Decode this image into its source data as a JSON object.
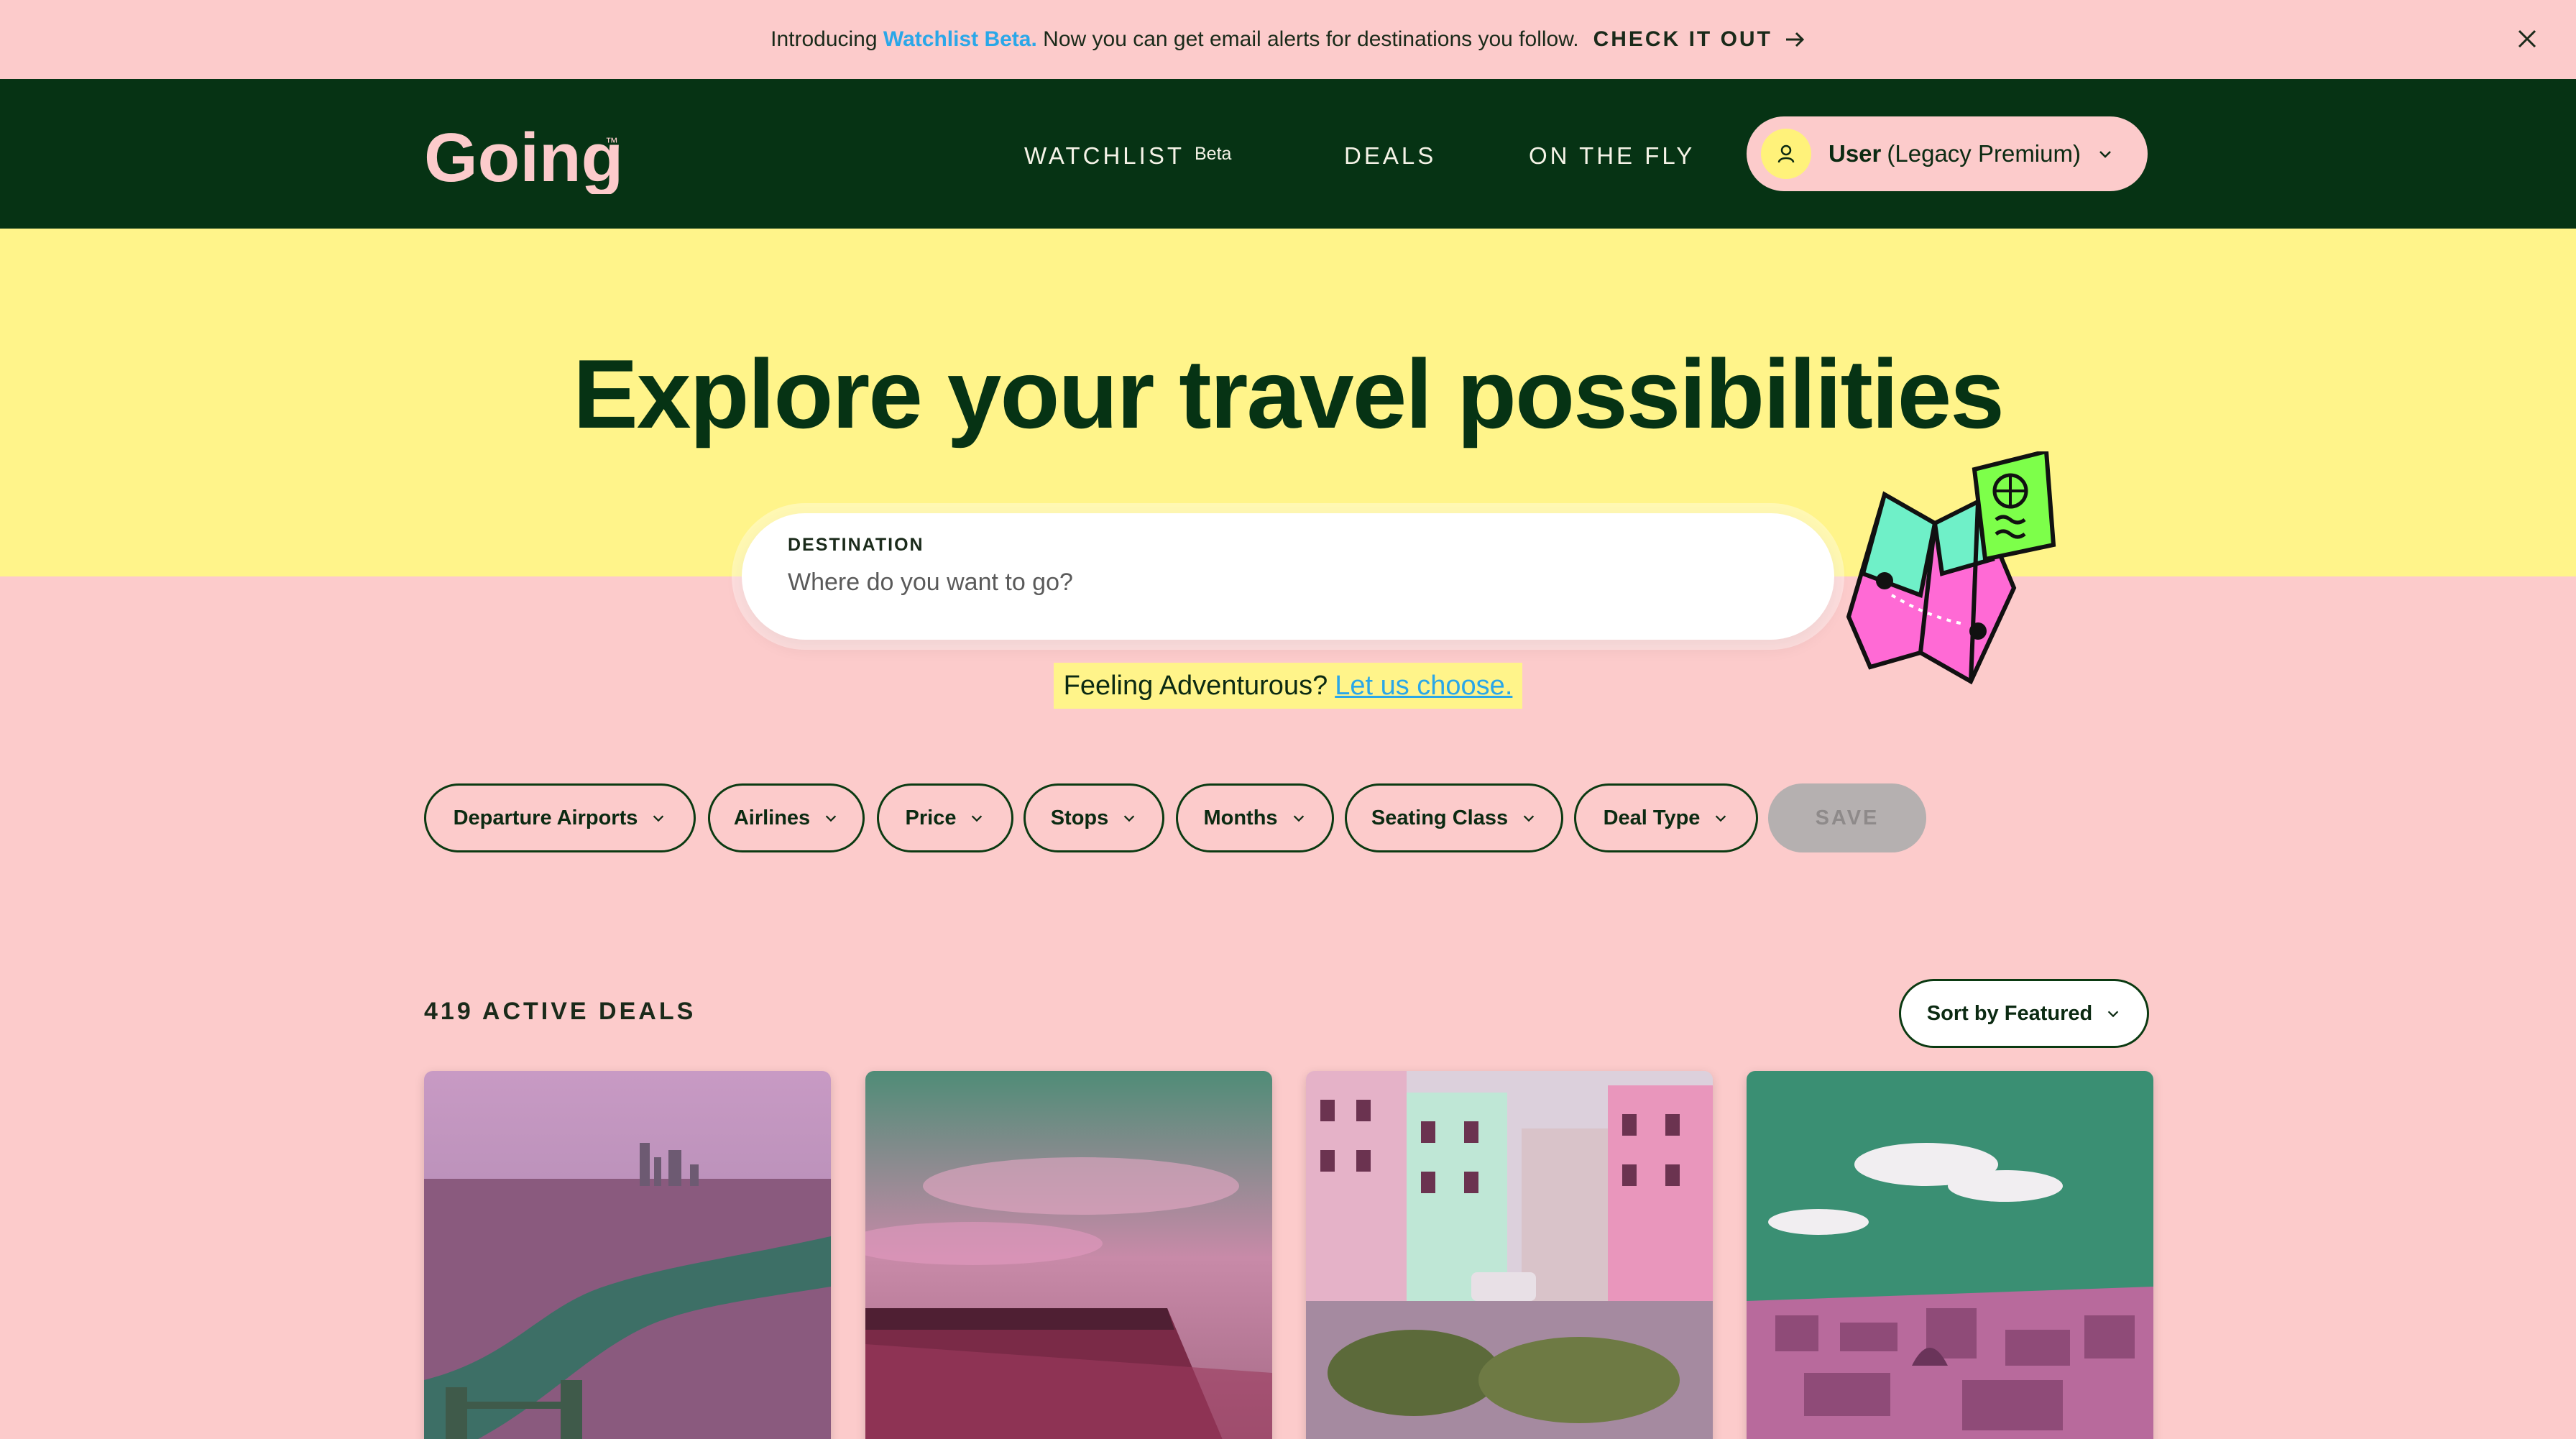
{
  "announcement": {
    "prefix": "Introducing",
    "highlight": "Watchlist Beta.",
    "text": "Now you can get email alerts for destinations you follow.",
    "cta": "CHECK IT OUT"
  },
  "nav": {
    "brand": "Going",
    "trademark": "™",
    "links": [
      {
        "label": "WATCHLIST",
        "badge": "Beta"
      },
      {
        "label": "DEALS"
      },
      {
        "label": "ON THE FLY"
      }
    ],
    "user": {
      "name": "User",
      "plan": "(Legacy Premium)"
    }
  },
  "hero": {
    "title": "Explore your travel possibilities",
    "search": {
      "label": "DESTINATION",
      "placeholder": "Where do you want to go?"
    },
    "adventure": {
      "text": "Feeling Adventurous?",
      "link": "Let us choose."
    }
  },
  "filters": [
    "Departure Airports",
    "Airlines",
    "Price",
    "Stops",
    "Months",
    "Seating Class",
    "Deal Type"
  ],
  "save_label": "SAVE",
  "deals": {
    "count_label": "419 ACTIVE DEALS",
    "sort_label": "Sort by Featured"
  },
  "colors": {
    "dark_green": "#063314",
    "pink": "#fccbcb",
    "yellow": "#fff48a",
    "link_blue": "#2aa7e8"
  }
}
